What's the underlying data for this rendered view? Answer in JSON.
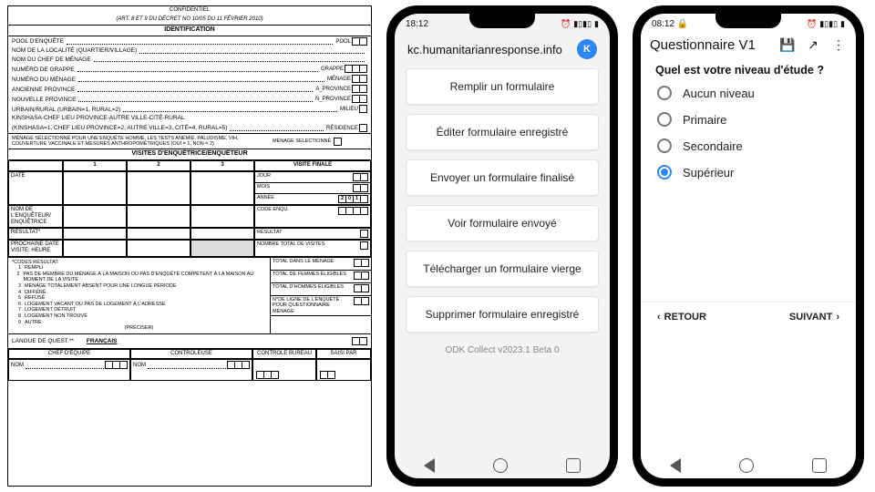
{
  "paper": {
    "confidential_line": "CONFIDENTIEL",
    "decree_line": "(ART. 8 ET 9 DU DÉCRET NO 10/05 DU 11 FÉVRIER 2010)",
    "section_ident": "IDENTIFICATION",
    "fields": {
      "pool_enq": "POOL D'ENQUÊTE",
      "localite": "NOM DE LA LOCALITÉ (QUARTIER/VILLAGE)",
      "chef": "NOM DU CHEF DE MÉNAGE",
      "grappe": "NUMÉRO DE GRAPPE",
      "menage": "NUMÉRO DU MÉNAGE",
      "anc_prov": "ANCIENNE PROVINCE",
      "nou_prov": "NOUVELLE PROVINCE",
      "urbain": "URBAIN/RURAL (URBAIN=1, RURAL=2)",
      "kinshasa1": "KINSHASA-CHEF LIEU PROVINCE-AUTRE VILLE-CITÉ-RURAL",
      "kinshasa2": "(KINSHASA=1, CHEF LIEU PROVINCE=2, AUTRE VILLE=3, CITÉ=4, RURAL=5)"
    },
    "right_labels": {
      "pool": "POOL",
      "grappe": "GRAPPE",
      "menage": "MÉNAGE",
      "a_prov": "A_PROVINCE",
      "n_prov": "N_PROVINCE",
      "milieu": "MILIEU",
      "residence": "RÉSIDENCE",
      "menage_sel": "MÉNAGE SELECTIONNÉ"
    },
    "selection_note": "MÉNAGE SÉLECTIONNÉ POUR UNE ENQUÊTE HOMME, LES TESTS ANÉMIE, PALUDISME, VIH, COUVERTURE VACCINALE ET MESURES ANTHROPOMÉTRIQUES (OUI = 1, NON = 2)",
    "section_visits": "VISITES D'ENQUÊTRICE/ENQUÊTEUR",
    "visits": {
      "cols": [
        "1",
        "2",
        "3"
      ],
      "final": "VISITE FINALE",
      "date": "DATE",
      "enq": "NOM DE L'ENQUÊTEUR/ ENQUÊTRICE",
      "res": "RÉSULTAT*",
      "next_date": "PROCHAINE   DATE",
      "next_time": "VISITE:        HEURE",
      "jour": "JOUR",
      "mois": "MOIS",
      "annee": "ANNÉE",
      "annee_val": [
        "2",
        "0",
        "1",
        ""
      ],
      "code_enq": "CODE ENQU.",
      "resultat": "RÉSULTAT",
      "nb_visites": "NOMBRE TOTAL DE VISITES"
    },
    "codes_title": "*CODES RÉSULTAT:",
    "codes": [
      {
        "n": "1",
        "t": "REMPLI"
      },
      {
        "n": "2",
        "t": "PAS DE MEMBRE DU MÉNAGE À LA MAISON OU PAS D'ENQUÊTÉ COMPÉTENT À LA MAISON AU MOMENT DE LA VISITE"
      },
      {
        "n": "3",
        "t": "MÉNAGE TOTALEMENT ABSENT POUR UNE LONGUE PÉRIODE"
      },
      {
        "n": "4",
        "t": "DIFFÉRÉ"
      },
      {
        "n": "5",
        "t": "REFUSÉ"
      },
      {
        "n": "6",
        "t": "LOGEMENT VACANT OU PAS DE LOGEMENT À L'ADRESSE"
      },
      {
        "n": "7",
        "t": "LOGEMENT DÉTRUIT"
      },
      {
        "n": "8",
        "t": "LOGEMENT NON TROUVÉ"
      },
      {
        "n": "9",
        "t": "AUTRE"
      }
    ],
    "preciser": "(PRÉCISER)",
    "right_stats": [
      "TOTAL DANS LE MÉNAGE",
      "TOTAL DE FEMMES ÉLIGIBLES",
      "TOTAL D'HOMMES ÉLIGIBLES",
      "N°DE LIGNE DE L'ENQUÊTÉ POUR QUESTIONNAIRE MÉNAGE"
    ],
    "lang_label": "LANGUE DE QUEST.**",
    "lang_value": "FRANÇAIS",
    "sig": {
      "chef": "CHEF D'ÉQUIPE",
      "ctrl": "CONTRÔLEUSE",
      "bureau": "CONTRÔLE BUREAU",
      "saisi": "SAISI PAR",
      "nom": "NOM"
    }
  },
  "phone1": {
    "status_time": "18:12",
    "title": "kc.humanitarianresponse.info",
    "avatar_letter": "K",
    "buttons": [
      "Remplir un formulaire",
      "Éditer formulaire enregistré",
      "Envoyer un formulaire finalisé",
      "Voir formulaire envoyé",
      "Télécharger un formulaire vierge",
      "Supprimer formulaire enregistré"
    ],
    "footer": "ODK Collect v2023.1 Beta 0"
  },
  "phone2": {
    "status_time": "08:12",
    "title": "Questionnaire V1",
    "question": "Quel est votre niveau d'étude ?",
    "options": [
      {
        "label": "Aucun niveau",
        "selected": false
      },
      {
        "label": "Primaire",
        "selected": false
      },
      {
        "label": "Secondaire",
        "selected": false
      },
      {
        "label": "Supérieur",
        "selected": true
      }
    ],
    "back": "RETOUR",
    "next": "SUIVANT"
  }
}
